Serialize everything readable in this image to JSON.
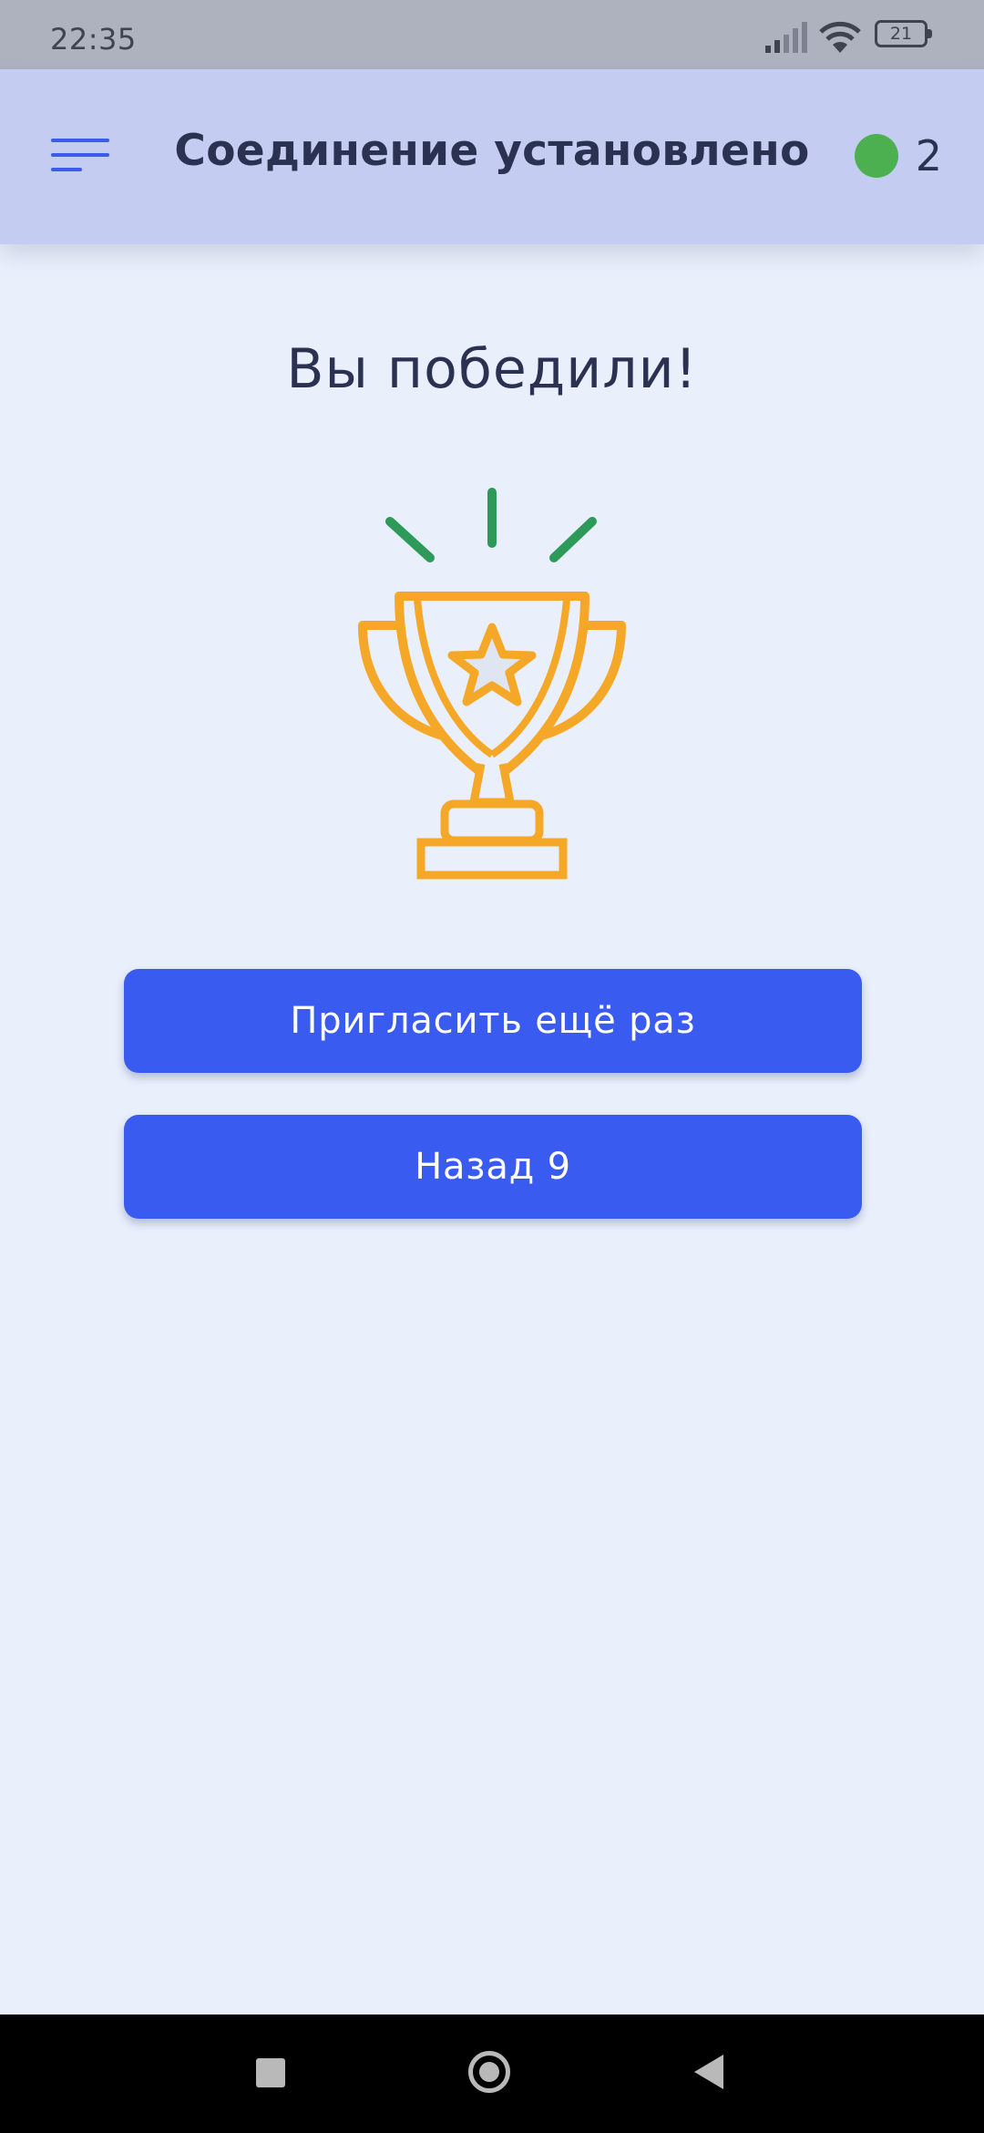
{
  "status_bar": {
    "time": "22:35",
    "battery_level": "21",
    "icons": [
      "signal-icon",
      "wifi-icon",
      "battery-icon"
    ]
  },
  "app_bar": {
    "title": "Соединение установлено",
    "menu_icon": "hamburger-menu-icon",
    "online_count": "2",
    "online_color": "#4caf50"
  },
  "main": {
    "result_title": "Вы победили!",
    "trophy_icon": "trophy-icon",
    "buttons": {
      "invite_again": "Пригласить ещё раз",
      "back": "Назад 9"
    }
  },
  "nav_bar": {
    "icons": [
      "recent-apps-icon",
      "home-icon",
      "back-icon"
    ]
  },
  "colors": {
    "background": "#eaf0fb",
    "app_bar": "#c4cdf1",
    "accent": "#3a5bf0",
    "trophy": "#f5a728",
    "sparkle": "#2e9a5a"
  }
}
